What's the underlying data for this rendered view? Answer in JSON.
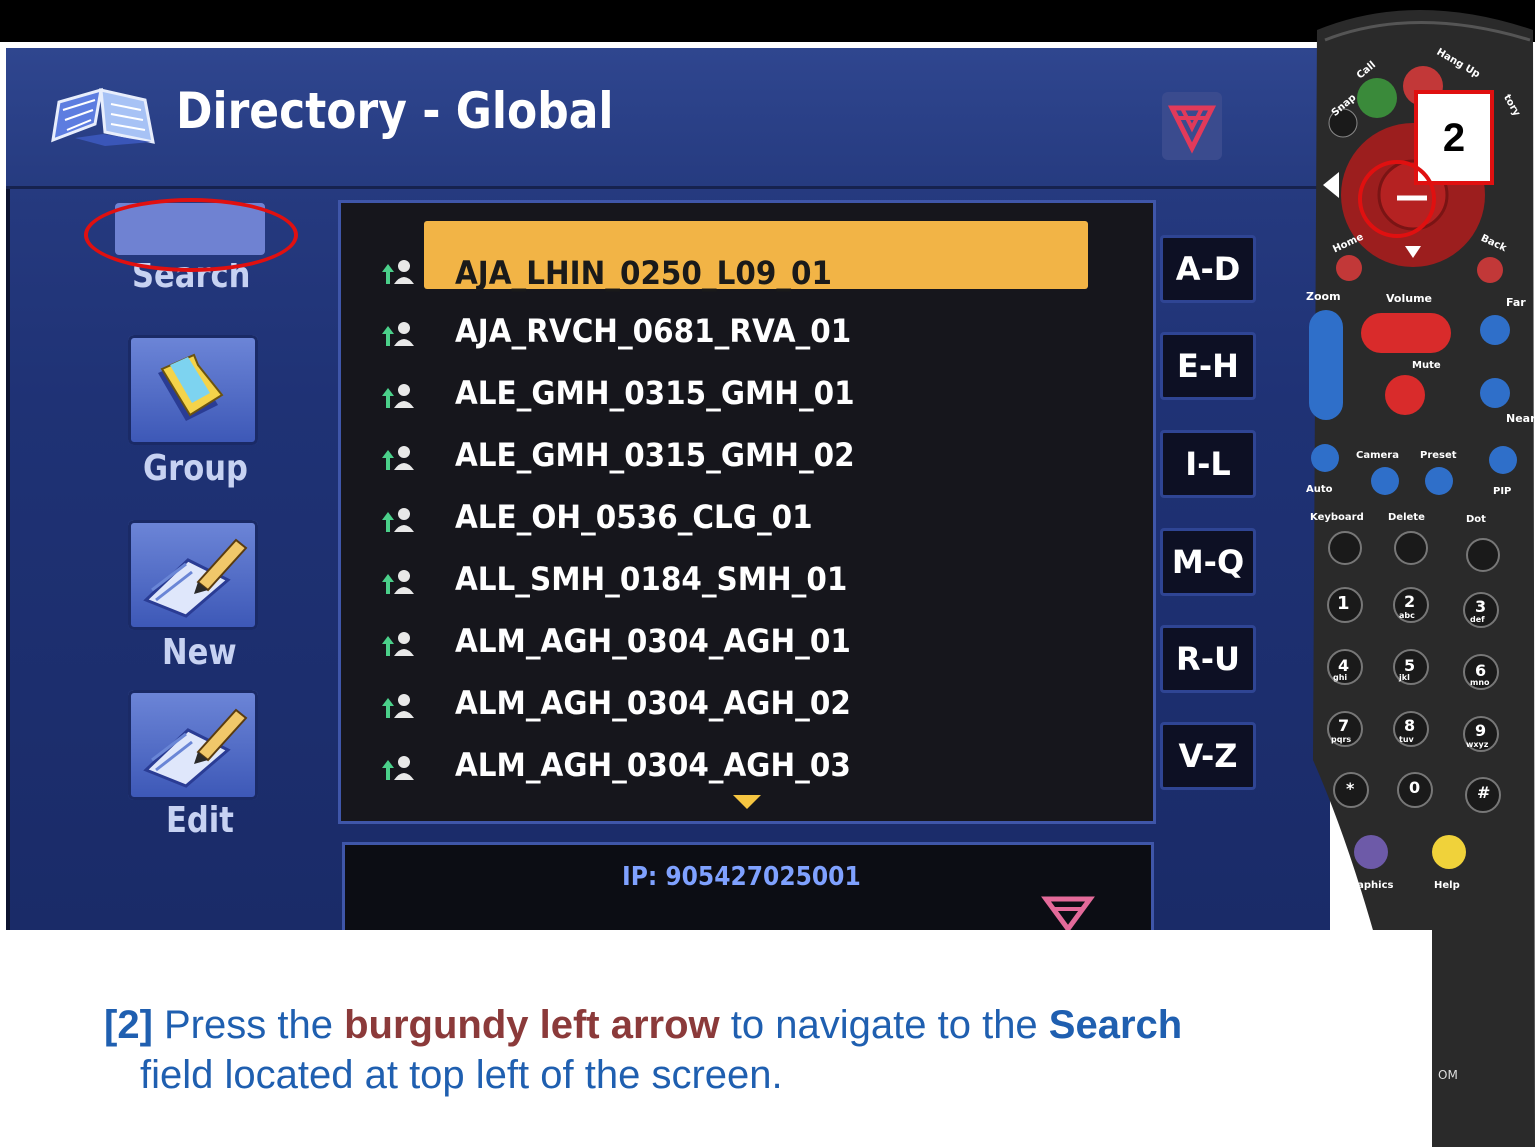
{
  "screen": {
    "title": "Directory - Global",
    "sidebar": [
      {
        "label": "Search",
        "icon": "search-field-icon"
      },
      {
        "label": "Group",
        "icon": "folder-icon"
      },
      {
        "label": "New",
        "icon": "new-entry-pencil-icon"
      },
      {
        "label": "Edit",
        "icon": "edit-pencil-icon"
      }
    ],
    "entries": [
      "AJA_LHIN_0250_L09_01",
      "AJA_RVCH_0681_RVA_01",
      "ALE_GMH_0315_GMH_01",
      "ALE_GMH_0315_GMH_02",
      "ALE_OH_0536_CLG_01",
      "ALL_SMH_0184_SMH_01",
      "ALM_AGH_0304_AGH_01",
      "ALM_AGH_0304_AGH_02",
      "ALM_AGH_0304_AGH_03"
    ],
    "selected_index": 0,
    "alpha_buttons": [
      "A-D",
      "E-H",
      "I-L",
      "M-Q",
      "R-U",
      "V-Z"
    ],
    "ip_text": "IP: 905427025001"
  },
  "remote": {
    "labels": {
      "call": "Call",
      "hangup": "Hang Up",
      "snap": "Snap",
      "directory": "tory",
      "home": "Home",
      "back": "Back",
      "zoom": "Zoom",
      "volume": "Volume",
      "far": "Far",
      "mute": "Mute",
      "near": "Near",
      "camera": "Camera",
      "preset": "Preset",
      "auto": "Auto",
      "pip": "PIP",
      "keyboard": "Keyboard",
      "delete": "Delete",
      "dot": "Dot",
      "graphics": "Graphics",
      "help": "Help",
      "brand": "OM"
    },
    "keys": [
      "1",
      "2",
      "3",
      "4",
      "5",
      "6",
      "7",
      "8",
      "9",
      "*",
      "0",
      "#"
    ],
    "key_letters": [
      "",
      "abc",
      "def",
      "ghi",
      "jkl",
      "mno",
      "pqrs",
      "tuv",
      "wxyz",
      "",
      "",
      ""
    ],
    "callout": "2"
  },
  "instruction": {
    "step": "[2]",
    "t1": " Press the ",
    "burgundy": "burgundy left arrow",
    "t2": " to navigate to the ",
    "search": "Search",
    "t3": "field located at top left of the screen."
  },
  "colors": {
    "burgundy": "#8b3a3a",
    "highlight": "#f2b446",
    "text_blue": "#1f5fb0",
    "callout_red": "#e01010"
  }
}
